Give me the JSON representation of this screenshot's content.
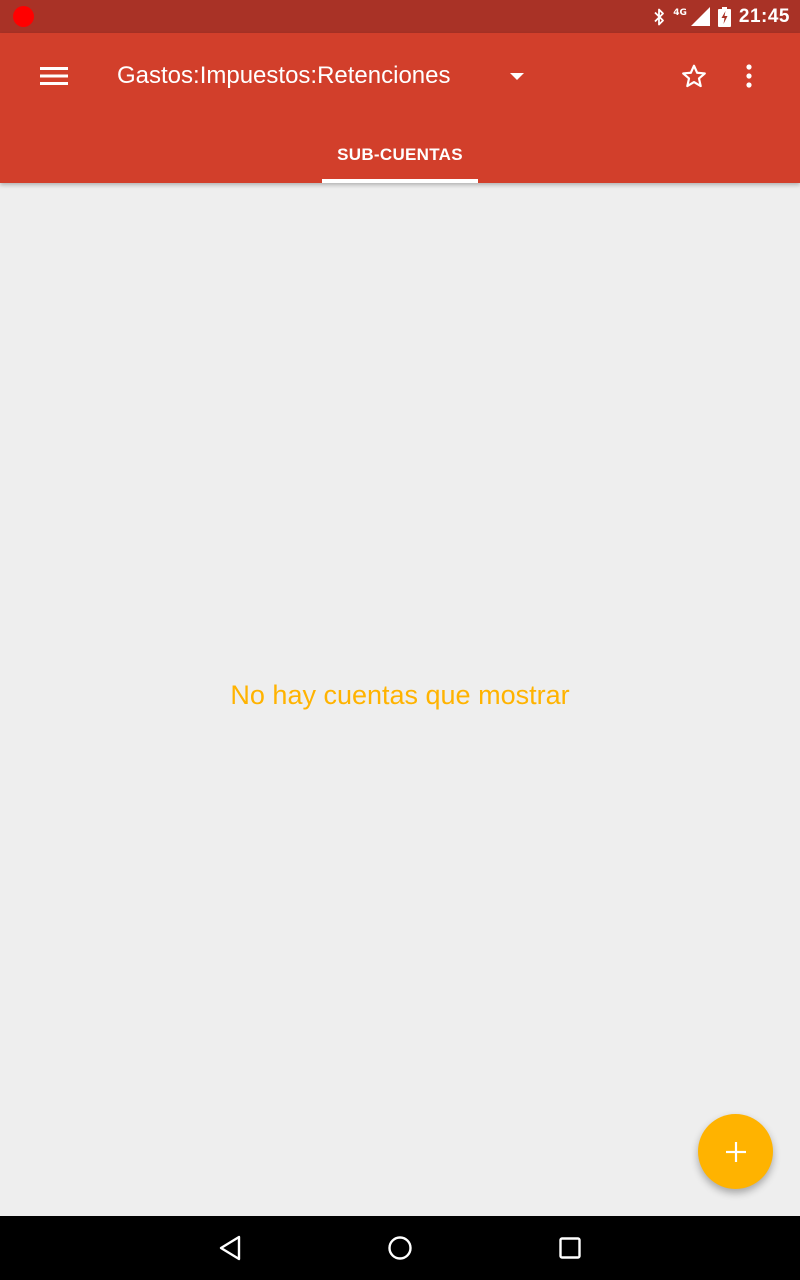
{
  "status_bar": {
    "time": "21:45",
    "network_label": "4G",
    "icons": [
      "recording-dot",
      "bluetooth-icon",
      "cell-signal-icon",
      "battery-charging-icon"
    ]
  },
  "app_bar": {
    "title": "Gastos:Impuestos:Retenciones",
    "icons": [
      "menu-icon",
      "dropdown-arrow-icon",
      "star-outline-icon",
      "more-vert-icon"
    ]
  },
  "tabs": [
    {
      "label": "SUB-CUENTAS",
      "selected": true
    }
  ],
  "main": {
    "empty_message": "No hay cuentas que mostrar"
  },
  "fab": {
    "icon": "plus-icon"
  },
  "nav_bar": {
    "icons": [
      "back-icon",
      "home-icon",
      "recents-icon"
    ]
  },
  "colors": {
    "status_bar": "#a93226",
    "app_bar": "#d23f2b",
    "accent": "#ffb300",
    "background": "#eeeeee"
  }
}
